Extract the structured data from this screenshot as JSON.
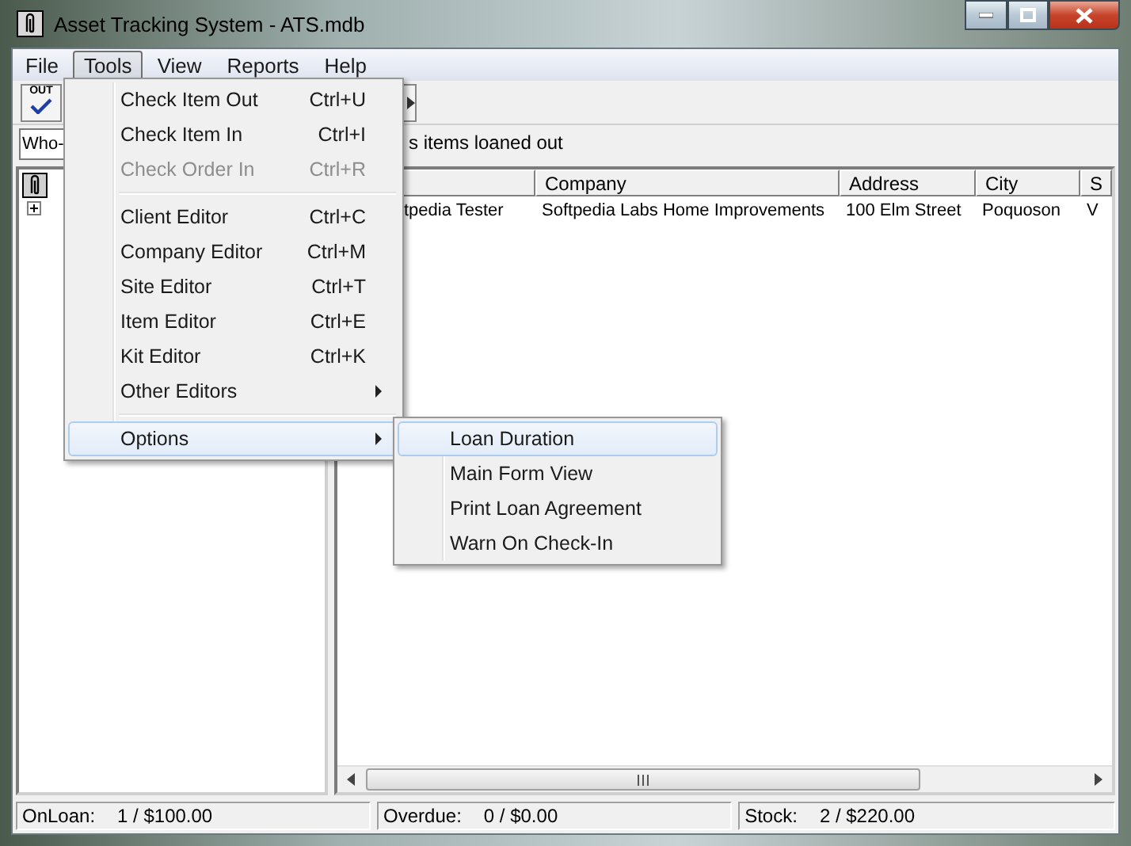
{
  "window": {
    "title": "Asset Tracking System - ATS.mdb"
  },
  "menu_bar": [
    {
      "label": "File",
      "selected": false
    },
    {
      "label": "Tools",
      "selected": true
    },
    {
      "label": "View",
      "selected": false
    },
    {
      "label": "Reports",
      "selected": false
    },
    {
      "label": "Help",
      "selected": false
    }
  ],
  "toolbar": {
    "out_button": {
      "label": "OUT"
    }
  },
  "view_selector": {
    "value": "Who-"
  },
  "description": "s items loaned out",
  "tree": {
    "nodes": [
      {
        "expanded": false
      }
    ]
  },
  "list": {
    "columns": [
      {},
      {
        "label": "Company"
      },
      {
        "label": "Address"
      },
      {
        "label": "City"
      },
      {
        "label": "S"
      }
    ],
    "rows": [
      [
        "tpedia Tester",
        "Softpedia Labs Home Improvements",
        "100 Elm Street",
        "Poquoson",
        "V"
      ]
    ]
  },
  "tools_menu": {
    "items": [
      {
        "kind": "item",
        "label": "Check Item Out",
        "shortcut": "Ctrl+U",
        "disabled": false
      },
      {
        "kind": "item",
        "label": "Check Item In",
        "shortcut": "Ctrl+I",
        "disabled": false
      },
      {
        "kind": "item",
        "label": "Check Order In",
        "shortcut": "Ctrl+R",
        "disabled": true
      },
      {
        "kind": "separator"
      },
      {
        "kind": "item",
        "label": "Client Editor",
        "shortcut": "Ctrl+C",
        "disabled": false
      },
      {
        "kind": "item",
        "label": "Company Editor",
        "shortcut": "Ctrl+M",
        "disabled": false
      },
      {
        "kind": "item",
        "label": "Site Editor",
        "shortcut": "Ctrl+T",
        "disabled": false
      },
      {
        "kind": "item",
        "label": "Item Editor",
        "shortcut": "Ctrl+E",
        "disabled": false
      },
      {
        "kind": "item",
        "label": "Kit Editor",
        "shortcut": "Ctrl+K",
        "disabled": false
      },
      {
        "kind": "submenu",
        "label": "Other Editors",
        "selected": false
      },
      {
        "kind": "separator"
      },
      {
        "kind": "submenu",
        "label": "Options",
        "selected": true
      }
    ]
  },
  "options_submenu": {
    "items": [
      {
        "label": "Loan Duration",
        "selected": true
      },
      {
        "label": "Main Form View",
        "selected": false
      },
      {
        "label": "Print Loan Agreement",
        "selected": false
      },
      {
        "label": "Warn On Check-In",
        "selected": false
      }
    ]
  },
  "status_bar": [
    {
      "label": "OnLoan:",
      "value": "1 / $100.00"
    },
    {
      "label": "Overdue:",
      "value": "0 / $0.00"
    },
    {
      "label": "Stock:",
      "value": "2 / $220.00"
    }
  ]
}
